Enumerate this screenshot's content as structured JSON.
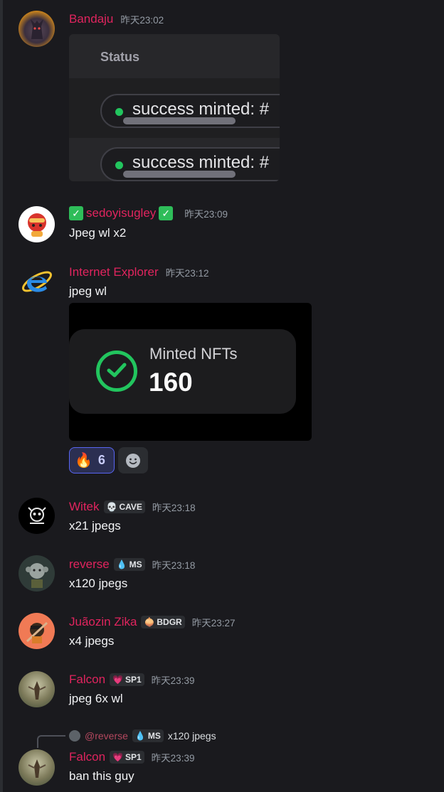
{
  "messages": [
    {
      "username": "Bandaju",
      "timestamp": "昨天23:02",
      "embed": {
        "status_label": "Status",
        "rows": [
          "success minted: #",
          "success minted: #"
        ]
      }
    },
    {
      "username": "sedoyisugley",
      "timestamp": "昨天23:09",
      "text": "Jpeg wl x2"
    },
    {
      "username": "Internet Explorer",
      "timestamp": "昨天23:12",
      "text": "jpeg wl",
      "embed": {
        "label": "Minted NFTs",
        "value": "160"
      },
      "reaction": {
        "emoji": "🔥",
        "count": "6"
      }
    },
    {
      "username": "Witek",
      "tag": {
        "emoji": "💀",
        "label": "CAVE"
      },
      "timestamp": "昨天23:18",
      "text": "x21 jpegs"
    },
    {
      "username": "reverse",
      "tag": {
        "emoji": "💧",
        "label": "MS"
      },
      "timestamp": "昨天23:18",
      "text": "x120 jpegs"
    },
    {
      "username": "Juãozin Zika",
      "tag": {
        "emoji": "🧅",
        "label": "BDGR"
      },
      "timestamp": "昨天23:27",
      "text": "x4 jpegs"
    },
    {
      "username": "Falcon",
      "tag": {
        "emoji": "💗",
        "label": "SP1"
      },
      "timestamp": "昨天23:39",
      "text": "jpeg 6x wl"
    },
    {
      "username": "Falcon",
      "tag": {
        "emoji": "💗",
        "label": "SP1"
      },
      "timestamp": "昨天23:39",
      "text": "ban this guy",
      "reply_to": {
        "username": "@reverse",
        "tag": {
          "emoji": "💧",
          "label": "MS"
        },
        "text": "x120 jpegs"
      }
    }
  ],
  "colors": {
    "background": "#1a1a1e",
    "username": "#e0245e",
    "timestamp": "#949ba4",
    "success": "#22c55e",
    "reaction_accent": "#5865f2"
  }
}
